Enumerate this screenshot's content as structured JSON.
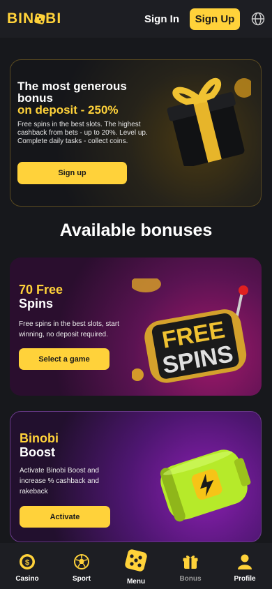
{
  "header": {
    "logo_text": "BINOBI",
    "sign_in_label": "Sign In",
    "sign_up_label": "Sign Up",
    "language_icon": "globe-icon"
  },
  "hero": {
    "title_white": "The most generous bonus",
    "title_yellow": "on deposit - 250%",
    "text": "Free spins in the best slots. The highest cashback from bets - up to 20%. Level up. Complete daily tasks - collect coins.",
    "button_label": "Sign up"
  },
  "section_title": "Available bonuses",
  "bonuses": [
    {
      "title_yellow": "70 Free",
      "title_white": "Spins",
      "text": "Free spins in the best slots, start winning, no deposit required.",
      "button_label": "Select a game",
      "graphic_text_top": "FREE",
      "graphic_text_bottom": "SPINS"
    },
    {
      "title_yellow": "Binobi",
      "title_white": "Boost",
      "text": "Activate Binobi Boost and increase % cashback and rakeback",
      "button_label": "Activate"
    }
  ],
  "bottom_nav": {
    "items": [
      {
        "label": "Casino",
        "icon": "casino-chip-icon"
      },
      {
        "label": "Sport",
        "icon": "soccer-ball-icon"
      },
      {
        "label": "Menu",
        "icon": "dice-icon"
      },
      {
        "label": "Bonus",
        "icon": "gift-icon",
        "active": true
      },
      {
        "label": "Profile",
        "icon": "user-icon"
      }
    ]
  },
  "colors": {
    "accent": "#ffd23a",
    "background": "#17181c",
    "header_bg": "#1d1e23"
  }
}
